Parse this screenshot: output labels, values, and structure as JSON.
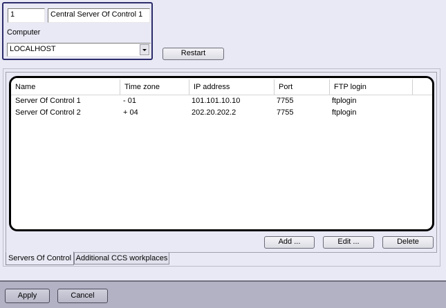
{
  "server": {
    "id": "1",
    "name": "Central Server Of Control 1"
  },
  "computer": {
    "label": "Computer",
    "value": "LOCALHOST"
  },
  "restart_label": "Restart",
  "table": {
    "columns": [
      "Name",
      "Time zone",
      "IP address",
      "Port",
      "FTP login"
    ],
    "rows": [
      [
        "Server Of Control 1",
        "- 01",
        "101.101.10.10",
        "7755",
        "ftplogin"
      ],
      [
        "Server Of Control 2",
        "+ 04",
        "202.20.202.2",
        "7755",
        "ftplogin"
      ]
    ]
  },
  "actions": {
    "add": "Add ...",
    "edit": "Edit ...",
    "delete": "Delete"
  },
  "tabs": [
    {
      "label": "Servers Of Control",
      "active": true
    },
    {
      "label": "Additional CCS workplaces",
      "active": false
    }
  ],
  "footer": {
    "apply": "Apply",
    "cancel": "Cancel"
  },
  "colors": {
    "highlight_border": "#000000",
    "panel_border": "#2b2b6b",
    "background": "#e9e9f5",
    "footer": "#b3b1c4"
  },
  "icons": {
    "dropdown": "chevron-down-icon"
  }
}
